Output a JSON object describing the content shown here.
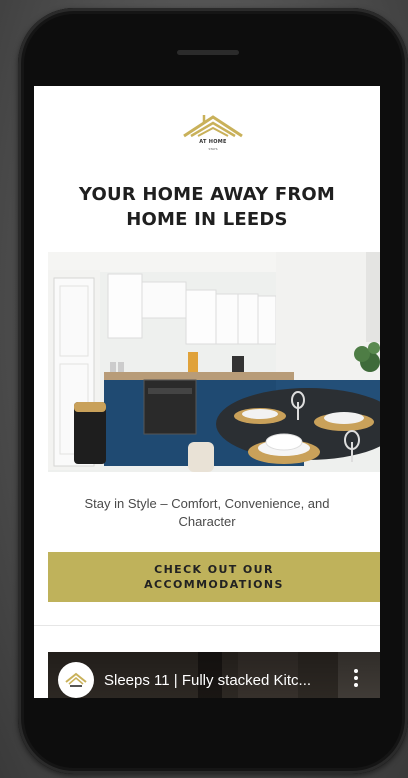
{
  "logo": {
    "name": "AT HOME",
    "subtext": "STAYS",
    "color": "#c9b15a"
  },
  "headline": "YOUR HOME AWAY FROM HOME IN LEEDS",
  "hero_image": {
    "alt": "Kitchen and dining area with navy cabinets and set table"
  },
  "tagline": "Stay in Style – Comfort, Convenience, and Character",
  "cta": {
    "label": "CHECK OUT OUR ACCOMMODATIONS",
    "color": "#bfb25b"
  },
  "video": {
    "title": "Sleeps 11 | Fully stacked Kitc..."
  },
  "colors": {
    "accent": "#bfb25b",
    "phone_body": "#0d0d0d",
    "screen_bg": "#ffffff"
  }
}
